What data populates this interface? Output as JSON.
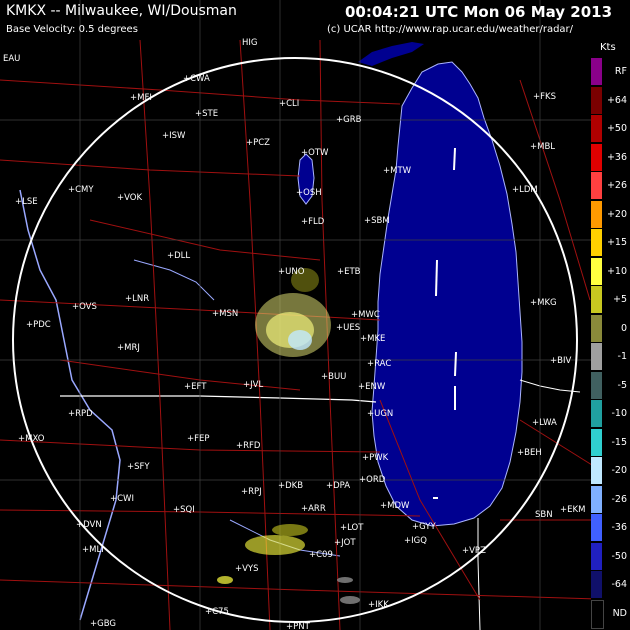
{
  "header": {
    "station": "KMKX -- Milwaukee, WI/Dousman",
    "product": "Base Velocity: 0.5 degrees",
    "timestamp": "00:04:21 UTC Mon 06 May 2013",
    "credit": "(c) UCAR  http://www.rap.ucar.edu/weather/radar/"
  },
  "legend": {
    "units": "Kts",
    "entries": [
      {
        "label": "RF",
        "color": "#8a008a"
      },
      {
        "label": "+64",
        "color": "#7a0000"
      },
      {
        "label": "+50",
        "color": "#b00000"
      },
      {
        "label": "+36",
        "color": "#e00000"
      },
      {
        "label": "+26",
        "color": "#ff4040"
      },
      {
        "label": "+20",
        "color": "#ff9a00"
      },
      {
        "label": "+15",
        "color": "#ffd000"
      },
      {
        "label": "+10",
        "color": "#ffff40"
      },
      {
        "label": "+5",
        "color": "#c8c820"
      },
      {
        "label": "0",
        "color": "#8a8a3a"
      },
      {
        "label": "-1",
        "color": "#a0a0a0"
      },
      {
        "label": "-5",
        "color": "#406060"
      },
      {
        "label": "-10",
        "color": "#20a0a0"
      },
      {
        "label": "-15",
        "color": "#30d0d0"
      },
      {
        "label": "-20",
        "color": "#c0e8ff"
      },
      {
        "label": "-26",
        "color": "#80b0ff"
      },
      {
        "label": "-36",
        "color": "#4060ff"
      },
      {
        "label": "-50",
        "color": "#2020c0"
      },
      {
        "label": "-64",
        "color": "#10106a"
      },
      {
        "label": "ND",
        "color": "#000000"
      }
    ]
  },
  "cities": [
    "EAU",
    "MDW",
    "HIG",
    "CWA",
    "MFI",
    "STE",
    "CLI",
    "GRB",
    "ISW",
    "PCZ",
    "OTW",
    "MTW",
    "CMY",
    "VOK",
    "OSH",
    "LSE",
    "FLD",
    "SBM",
    "DLL",
    "UNO",
    "ETB",
    "LNR",
    "OVS",
    "MSN",
    "PDC",
    "MWC",
    "UES",
    "MRJ",
    "MKE",
    "RAC",
    "EFT",
    "JVL",
    "BUU",
    "ENW",
    "RPD",
    "UGN",
    "MXO",
    "FEP",
    "RFD",
    "SFY",
    "PWK",
    "DKB",
    "DPA",
    "ORD",
    "CWI",
    "RPJ",
    "SQI",
    "ARR",
    "DVN",
    "MLI",
    "LOT",
    "JOT",
    "IGQ",
    "GYY",
    "VPZ",
    "C09",
    "VYS",
    "C75",
    "PNT",
    "IKK",
    "GBG",
    "MLT",
    "FKS",
    "MBL",
    "LDM",
    "MKG",
    "BIV",
    "LWA",
    "BEH",
    "SBN",
    "EKM",
    "MTW"
  ]
}
